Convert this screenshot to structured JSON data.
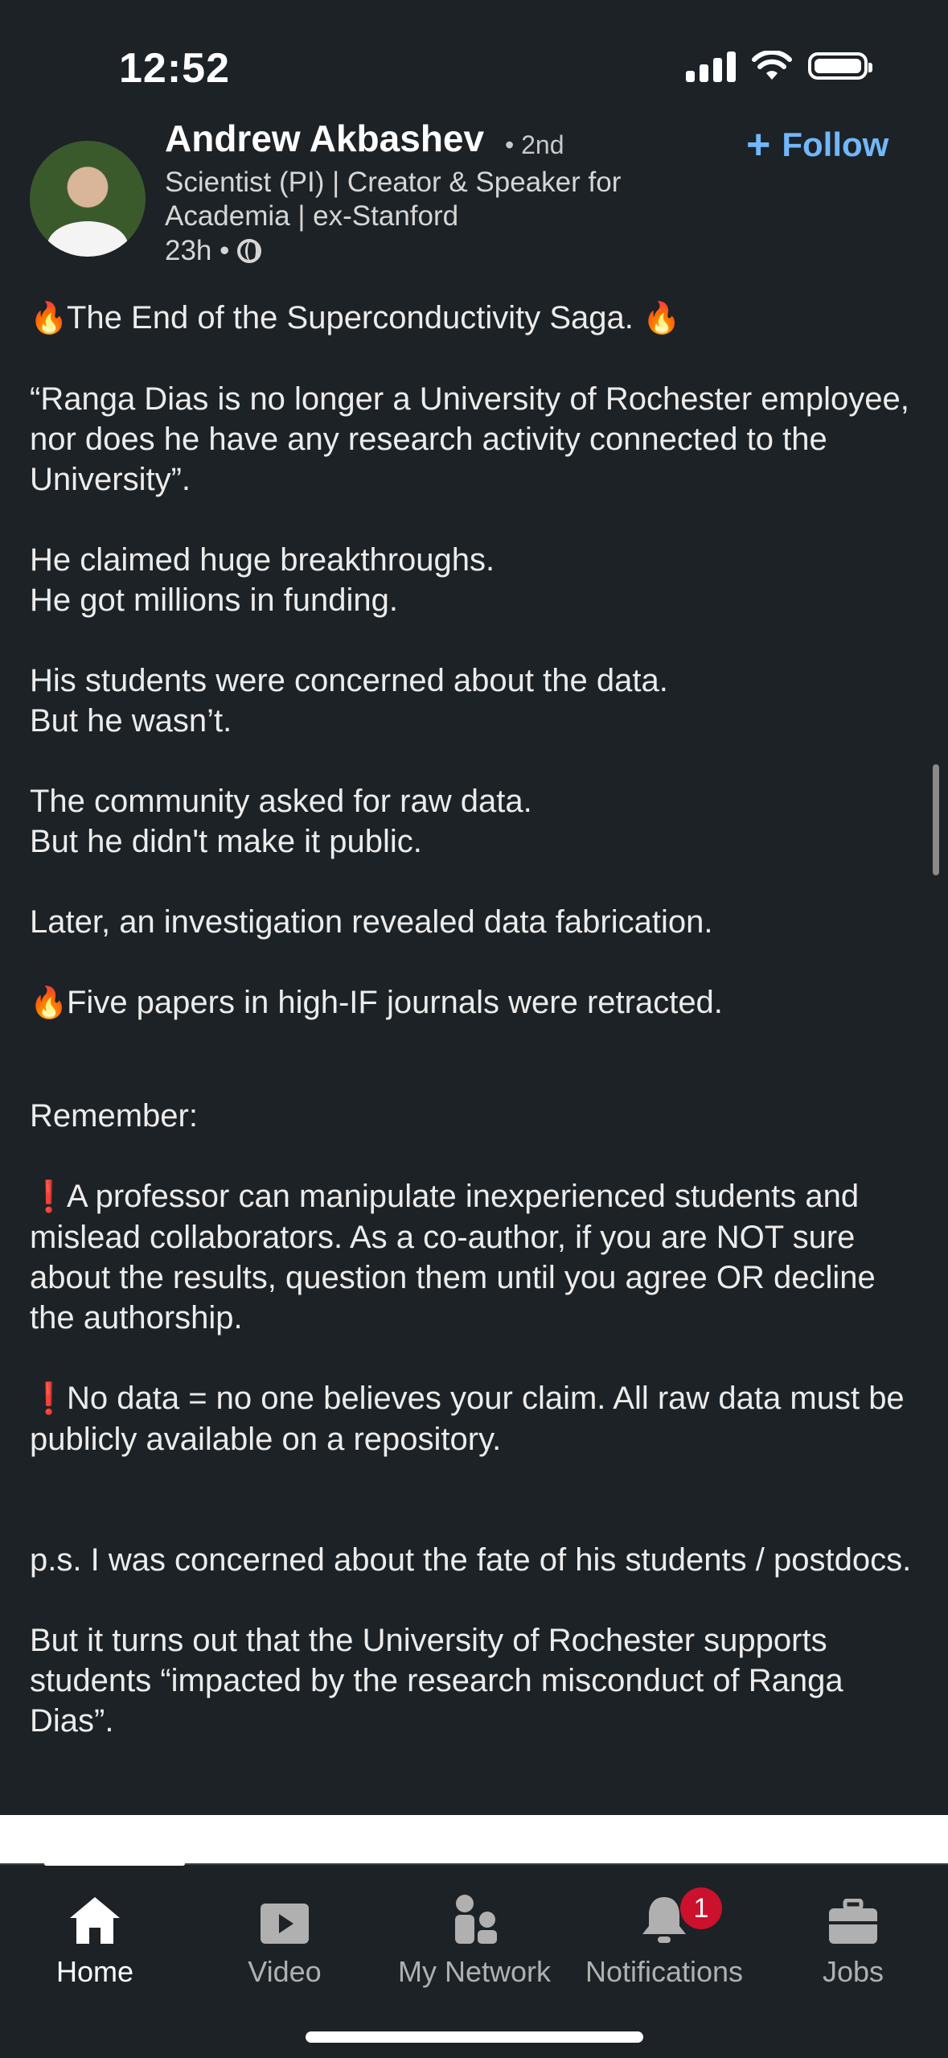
{
  "status_bar": {
    "time": "12:52"
  },
  "author": {
    "name": "Andrew Akbashev",
    "degree": "• 2nd",
    "follow_label": "Follow",
    "headline": "Scientist (PI) | Creator & Speaker for Academia | ex-Stanford",
    "time_ago": "23h •"
  },
  "post": {
    "title": "The End of the Superconductivity Saga.",
    "quote": "“Ranga Dias is no longer a University of Rochester employee, nor does he have any research activity connected to the University”.",
    "p1_line1": "He claimed huge breakthroughs.",
    "p1_line2": "He got millions in funding.",
    "p2_line1": "His students were concerned about the data.",
    "p2_line2": "But he wasn’t.",
    "p3_line1": "The community asked for raw data.",
    "p3_line2": "But he didn't make it public.",
    "p4": "Later, an investigation revealed data fabrication.",
    "p5": "Five papers in high-IF journals were retracted.",
    "remember": "Remember:",
    "point1": "A professor can manipulate inexperienced students and mislead collaborators. As a co-author, if you are NOT sure about the results, question them until you agree OR decline the authorship.",
    "point2": "No data = no one believes your claim. All raw data must be publicly available on a repository.",
    "ps": "p.s. I was concerned about the fate of his students / postdocs.",
    "closing": "But it turns out that the University of Rochester supports students “impacted by the research misconduct of Ranga Dias”."
  },
  "tabs": [
    {
      "label": "Home",
      "icon": "home-icon"
    },
    {
      "label": "Video",
      "icon": "video-icon"
    },
    {
      "label": "My Network",
      "icon": "network-icon"
    },
    {
      "label": "Notifications",
      "icon": "bell-icon",
      "badge": "1"
    },
    {
      "label": "Jobs",
      "icon": "briefcase-icon"
    }
  ],
  "colors": {
    "background": "#1d2226",
    "link": "#71b7fb",
    "badge": "#cb112d"
  }
}
